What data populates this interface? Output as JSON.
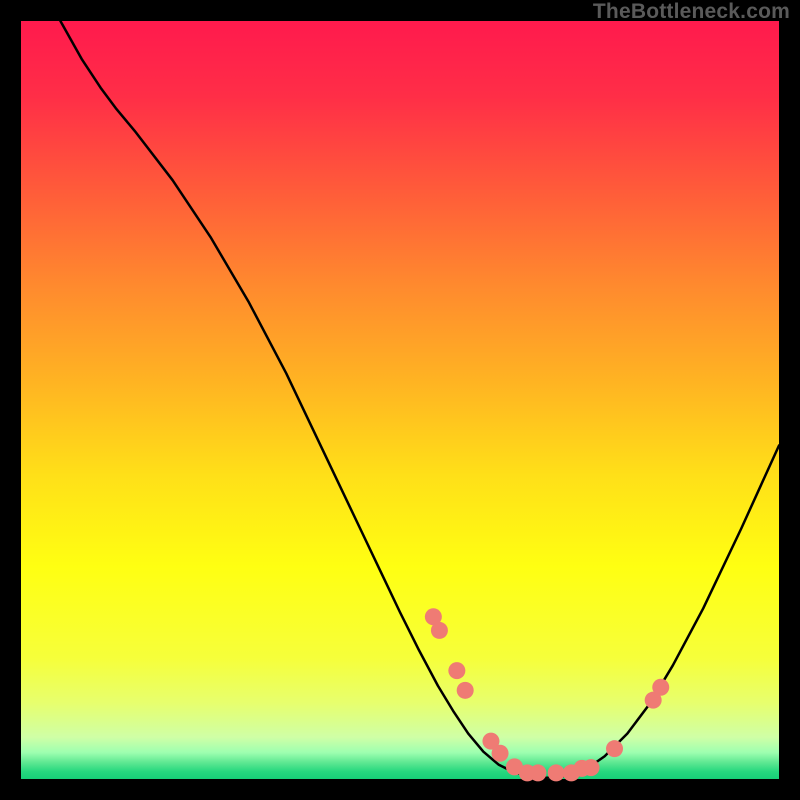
{
  "attribution": "TheBottleneck.com",
  "gradient_stops": [
    {
      "offset": 0.0,
      "color": "#ff1a4d"
    },
    {
      "offset": 0.1,
      "color": "#ff2e47"
    },
    {
      "offset": 0.22,
      "color": "#ff5a3a"
    },
    {
      "offset": 0.35,
      "color": "#ff8a2e"
    },
    {
      "offset": 0.48,
      "color": "#ffb522"
    },
    {
      "offset": 0.6,
      "color": "#ffe018"
    },
    {
      "offset": 0.72,
      "color": "#ffff12"
    },
    {
      "offset": 0.84,
      "color": "#f6ff3a"
    },
    {
      "offset": 0.9,
      "color": "#e7ff6e"
    },
    {
      "offset": 0.945,
      "color": "#cfffa6"
    },
    {
      "offset": 0.965,
      "color": "#9effb0"
    },
    {
      "offset": 0.978,
      "color": "#5fe892"
    },
    {
      "offset": 0.99,
      "color": "#27d87f"
    },
    {
      "offset": 1.0,
      "color": "#16cf78"
    }
  ],
  "dot_style": {
    "r": 8.5,
    "fill": "#ef7b74",
    "stroke": null
  },
  "chart_data": {
    "type": "line",
    "title": "",
    "xlabel": "",
    "ylabel": "",
    "xlim": [
      0,
      100
    ],
    "ylim": [
      0,
      100
    ],
    "grid": false,
    "curve": [
      {
        "x": 3.2,
        "y": 104.0
      },
      {
        "x": 5.2,
        "y": 100.0
      },
      {
        "x": 8.0,
        "y": 95.0
      },
      {
        "x": 10.5,
        "y": 91.2
      },
      {
        "x": 12.5,
        "y": 88.5
      },
      {
        "x": 15.0,
        "y": 85.5
      },
      {
        "x": 20.0,
        "y": 79.0
      },
      {
        "x": 25.0,
        "y": 71.5
      },
      {
        "x": 30.0,
        "y": 63.0
      },
      {
        "x": 35.0,
        "y": 53.5
      },
      {
        "x": 40.0,
        "y": 43.0
      },
      {
        "x": 45.0,
        "y": 32.5
      },
      {
        "x": 50.0,
        "y": 22.0
      },
      {
        "x": 52.5,
        "y": 17.0
      },
      {
        "x": 55.0,
        "y": 12.3
      },
      {
        "x": 57.0,
        "y": 9.0
      },
      {
        "x": 59.0,
        "y": 6.0
      },
      {
        "x": 61.0,
        "y": 3.6
      },
      {
        "x": 63.0,
        "y": 1.9
      },
      {
        "x": 65.0,
        "y": 0.9
      },
      {
        "x": 67.0,
        "y": 0.35
      },
      {
        "x": 69.0,
        "y": 0.15
      },
      {
        "x": 71.0,
        "y": 0.25
      },
      {
        "x": 73.0,
        "y": 0.7
      },
      {
        "x": 75.0,
        "y": 1.6
      },
      {
        "x": 77.0,
        "y": 3.0
      },
      {
        "x": 80.0,
        "y": 6.0
      },
      {
        "x": 83.0,
        "y": 10.0
      },
      {
        "x": 86.0,
        "y": 15.0
      },
      {
        "x": 90.0,
        "y": 22.5
      },
      {
        "x": 95.0,
        "y": 33.0
      },
      {
        "x": 100.0,
        "y": 44.0
      }
    ],
    "series": [
      {
        "name": "highlighted-points",
        "points": [
          {
            "x": 54.4,
            "y": 21.4
          },
          {
            "x": 55.2,
            "y": 19.6
          },
          {
            "x": 57.5,
            "y": 14.3
          },
          {
            "x": 58.6,
            "y": 11.7
          },
          {
            "x": 62.0,
            "y": 5.0
          },
          {
            "x": 63.2,
            "y": 3.4
          },
          {
            "x": 65.1,
            "y": 1.6
          },
          {
            "x": 66.8,
            "y": 0.8
          },
          {
            "x": 68.2,
            "y": 0.8
          },
          {
            "x": 70.6,
            "y": 0.8
          },
          {
            "x": 72.6,
            "y": 0.8
          },
          {
            "x": 74.0,
            "y": 1.4
          },
          {
            "x": 75.2,
            "y": 1.5
          },
          {
            "x": 78.3,
            "y": 4.0
          },
          {
            "x": 83.4,
            "y": 10.4
          },
          {
            "x": 84.4,
            "y": 12.1
          }
        ]
      }
    ]
  }
}
